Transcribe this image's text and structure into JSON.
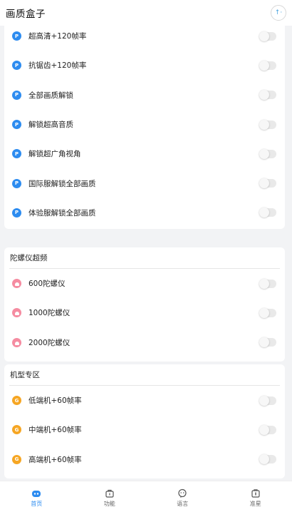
{
  "header": {
    "title": "画质盒子",
    "avatar_glyph": "↑·"
  },
  "sections": [
    {
      "title": "",
      "icon_style": "blue",
      "icon_name": "p-badge-icon",
      "icon_glyph": "P",
      "items": [
        {
          "label": "超高清+120帧率",
          "enabled": false
        },
        {
          "label": "抗锯齿+120帧率",
          "enabled": false
        },
        {
          "label": "全部画质解锁",
          "enabled": false
        },
        {
          "label": "解锁超高音质",
          "enabled": false
        },
        {
          "label": "解锁超广角视角",
          "enabled": false
        },
        {
          "label": "国际服解锁全部画质",
          "enabled": false
        },
        {
          "label": "体验服解锁全部画质",
          "enabled": false
        }
      ]
    },
    {
      "title": "陀螺仪超频",
      "icon_style": "pink",
      "icon_name": "gyro-badge-icon",
      "icon_glyph": "",
      "items": [
        {
          "label": "600陀螺仪",
          "enabled": false
        },
        {
          "label": "1000陀螺仪",
          "enabled": false
        },
        {
          "label": "2000陀螺仪",
          "enabled": false
        }
      ]
    },
    {
      "title": "机型专区",
      "icon_style": "orange",
      "icon_name": "g-badge-icon",
      "icon_glyph": "G",
      "items": [
        {
          "label": "低端机+60帧率",
          "enabled": false
        },
        {
          "label": "中端机+60帧率",
          "enabled": false
        },
        {
          "label": "高端机+60帧率",
          "enabled": false
        }
      ]
    }
  ],
  "tabs": [
    {
      "label": "首页",
      "icon": "home-icon",
      "active": true
    },
    {
      "label": "功能",
      "icon": "toolbox-icon",
      "active": false
    },
    {
      "label": "语言",
      "icon": "chat-face-icon",
      "active": false
    },
    {
      "label": "准星",
      "icon": "crosshair-card-icon",
      "active": false
    }
  ],
  "colors": {
    "accent": "#2d8cf0",
    "pink": "#f58ca1",
    "orange": "#f6a623",
    "background": "#f2f3f5"
  }
}
